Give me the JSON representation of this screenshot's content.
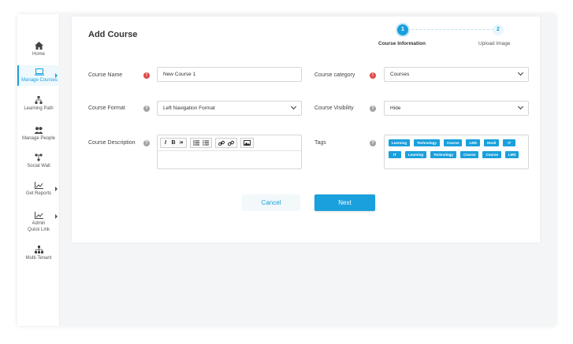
{
  "sidebar": {
    "items": [
      {
        "label": "Home",
        "icon": "home-icon"
      },
      {
        "label": "Manage Courses",
        "icon": "laptop-icon",
        "active": true
      },
      {
        "label": "Learning Path",
        "icon": "sitemap-icon"
      },
      {
        "label": "Manage People",
        "icon": "people-icon"
      },
      {
        "label": "Social Wall",
        "icon": "share-icon"
      },
      {
        "label": "Get Reports",
        "icon": "chart-icon"
      },
      {
        "label": "Admin Quick Link",
        "icon": "chart-icon"
      },
      {
        "label": "Multi-Tenant",
        "icon": "network-icon"
      }
    ]
  },
  "page": {
    "title": "Add Course"
  },
  "stepper": {
    "steps": [
      {
        "number": "1",
        "label": "Course Information"
      },
      {
        "number": "2",
        "label": "Upload Image"
      }
    ]
  },
  "form": {
    "course_name": {
      "label": "Course Name",
      "value": "New Course 1"
    },
    "course_category": {
      "label": "Course category",
      "value": "Courses"
    },
    "course_format": {
      "label": "Course Format",
      "value": "Left Navigation Format"
    },
    "course_visibility": {
      "label": "Course Visibility",
      "value": "Hide"
    },
    "course_description": {
      "label": "Course Description"
    },
    "tags": {
      "label": "Tags",
      "row1": [
        "Learning",
        "Technology",
        "Course",
        "LMS",
        "Hindi",
        "IT"
      ],
      "row2": [
        "IT",
        "Learning",
        "Technology",
        "Course",
        "Course",
        "LMS"
      ]
    },
    "editor_toolbar": {
      "italic": "I",
      "bold": "B",
      "format": "i▾"
    }
  },
  "buttons": {
    "cancel": "Cancel",
    "next": "Next"
  },
  "colors": {
    "accent": "#1aa0dc",
    "required": "#e04a4a",
    "help": "#a3a3a3"
  }
}
